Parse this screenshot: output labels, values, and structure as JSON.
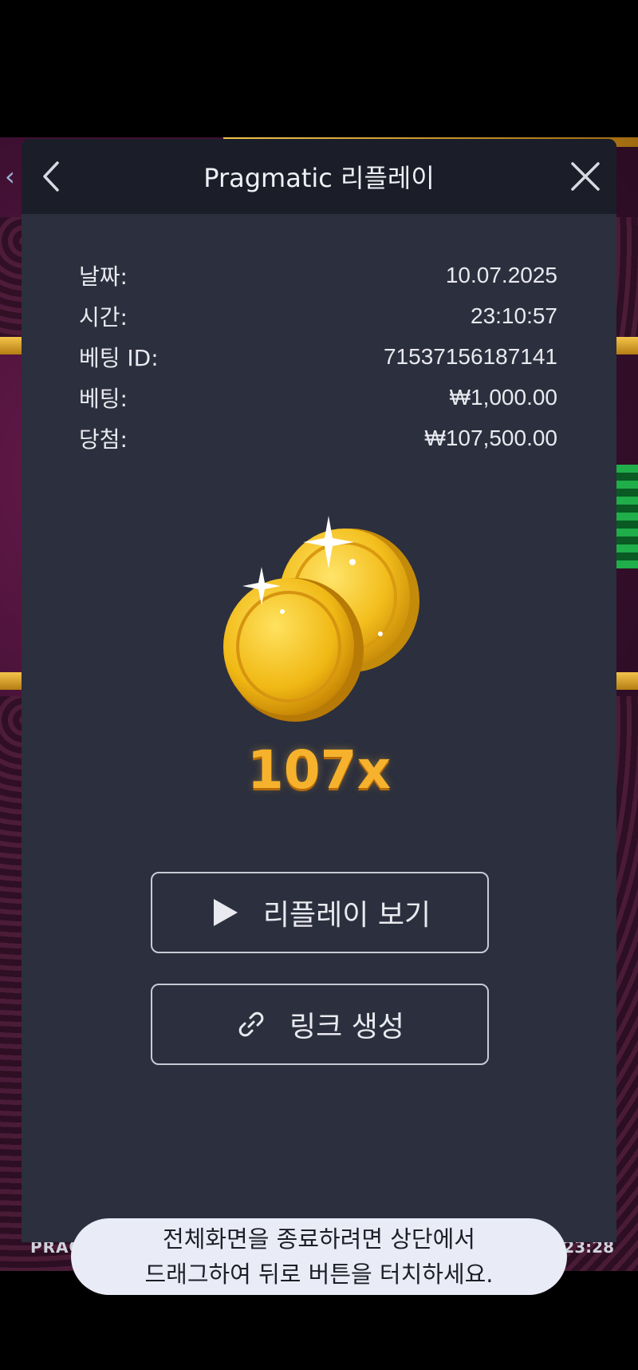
{
  "modal": {
    "title": "Pragmatic 리플레이",
    "rows": [
      {
        "label": "날짜:",
        "value": "10.07.2025"
      },
      {
        "label": "시간:",
        "value": "23:10:57"
      },
      {
        "label": "베팅 ID:",
        "value": "71537156187141"
      },
      {
        "label": "베팅:",
        "value": "₩1,000.00"
      },
      {
        "label": "당첨:",
        "value": "₩107,500.00"
      }
    ],
    "multiplier": "107x",
    "replay_button": "리플레이 보기",
    "link_button": "링크 생성"
  },
  "background": {
    "footer_left": "PRAG",
    "footer_right": "23:28"
  },
  "toast": {
    "line1": "전체화면을 종료하려면 상단에서",
    "line2": "드래그하여 뒤로 버튼을 터치하세요."
  },
  "icons": {
    "back": "chevron-left-icon",
    "close": "close-icon",
    "replay": "play-icon",
    "link": "link-icon",
    "coins": "gold-coins-icon"
  },
  "colors": {
    "modal_bg": "#2c2f3d",
    "header_bg": "#1b1d29",
    "multiplier": "#f6b22c",
    "toast_bg": "#e9ecf7"
  }
}
